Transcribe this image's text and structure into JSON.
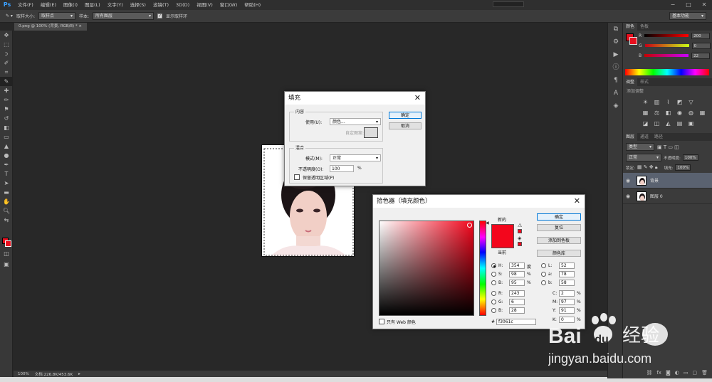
{
  "app": {
    "logo": "Ps"
  },
  "menu": [
    "文件(F)",
    "编辑(E)",
    "图像(I)",
    "图层(L)",
    "文字(Y)",
    "选择(S)",
    "滤镜(T)",
    "3D(D)",
    "视图(V)",
    "窗口(W)",
    "帮助(H)"
  ],
  "window_controls": [
    "−",
    "□",
    "✕"
  ],
  "options": {
    "sample_size_label": "取样大小:",
    "sample_size_value": "取样点",
    "sample_label": "样本:",
    "sample_value": "所有图层",
    "show_ring_label": "显示取样环",
    "workspace": "基本功能"
  },
  "doc_tab": "0.png @ 100% (背景, RGB/8) * ×",
  "status": {
    "zoom": "100%",
    "doc": "文档:226.8K/453.6K"
  },
  "colors": {
    "foreground": "#e8101f",
    "accent": "#f3061c"
  },
  "panels": {
    "color_tabs": [
      "颜色",
      "色板"
    ],
    "rgb": [
      {
        "label": "R",
        "value": "200"
      },
      {
        "label": "G",
        "value": "0"
      },
      {
        "label": "B",
        "value": "22"
      }
    ],
    "adjust_tabs": [
      "调整",
      "样式"
    ],
    "adjust_title": "添加调整",
    "layers_tabs": [
      "图层",
      "通道",
      "路径"
    ],
    "kind_label": "类型",
    "blend_mode": "正常",
    "opacity_label": "不透明度:",
    "opacity_value": "100%",
    "lock_label": "锁定:",
    "fill_label": "填充:",
    "fill_value": "100%",
    "layers": [
      {
        "name": "背景",
        "selected": true
      },
      {
        "name": "图层 0",
        "selected": false
      }
    ]
  },
  "fill_dialog": {
    "title": "填充",
    "content_group": "内容",
    "use_label": "使用(U):",
    "use_value": "颜色...",
    "custom_pattern_label": "自定图案:",
    "blend_group": "混合",
    "mode_label": "模式(M):",
    "mode_value": "正常",
    "opacity_label": "不透明度(O):",
    "opacity_value": "100",
    "opacity_unit": "%",
    "preserve_label": "保留透明区域(P)",
    "ok": "确定",
    "cancel": "取消"
  },
  "color_picker": {
    "title": "拾色器（填充颜色）",
    "new_label": "新的",
    "current_label": "当前",
    "ok": "确定",
    "reset": "复位",
    "add_swatch": "添加到色板",
    "color_libraries": "颜色库",
    "hsb": [
      {
        "label": "H:",
        "value": "354",
        "unit": "度"
      },
      {
        "label": "S:",
        "value": "98",
        "unit": "%"
      },
      {
        "label": "B:",
        "value": "95",
        "unit": "%"
      }
    ],
    "rgb": [
      {
        "label": "R:",
        "value": "243"
      },
      {
        "label": "G:",
        "value": "6"
      },
      {
        "label": "B:",
        "value": "28"
      }
    ],
    "lab": [
      {
        "label": "L:",
        "value": "52"
      },
      {
        "label": "a:",
        "value": "78"
      },
      {
        "label": "b:",
        "value": "58"
      }
    ],
    "cmyk": [
      {
        "label": "C:",
        "value": "2",
        "unit": "%"
      },
      {
        "label": "M:",
        "value": "97",
        "unit": "%"
      },
      {
        "label": "Y:",
        "value": "91",
        "unit": "%"
      },
      {
        "label": "K:",
        "value": "0",
        "unit": "%"
      }
    ],
    "hex_label": "#",
    "hex_value": "f3061c",
    "web_only_label": "只有 Web 颜色"
  },
  "watermark": {
    "brand": "Bai du 经验",
    "url": "jingyan.baidu.com"
  }
}
